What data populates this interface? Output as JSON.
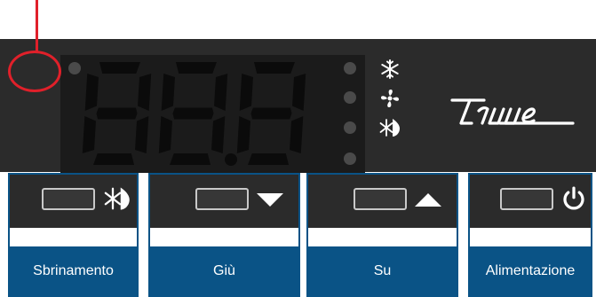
{
  "display": {
    "segments": [
      "8",
      "8",
      "8"
    ],
    "decimal_point": "."
  },
  "status_icons": [
    {
      "icon": "snowflake-icon",
      "meaning": "compressor"
    },
    {
      "icon": "fan-icon",
      "meaning": "fan"
    },
    {
      "icon": "defrost-icon",
      "meaning": "defrost"
    }
  ],
  "brand": {
    "logo": "true-logo"
  },
  "buttons": [
    {
      "label": "Sbrinamento",
      "icon": "defrost-icon"
    },
    {
      "label": "Giù",
      "icon": "down-arrow-icon"
    },
    {
      "label": "Su",
      "icon": "up-arrow-icon"
    },
    {
      "label": "Alimentazione",
      "icon": "power-icon"
    }
  ],
  "colors": {
    "panel": "#2b2b2b",
    "display": "#1b1b1b",
    "segment_off": "#0b0b0b",
    "accent_blue": "#0a5386",
    "indicator_red": "#e0202a",
    "icon_white": "#ffffff"
  }
}
